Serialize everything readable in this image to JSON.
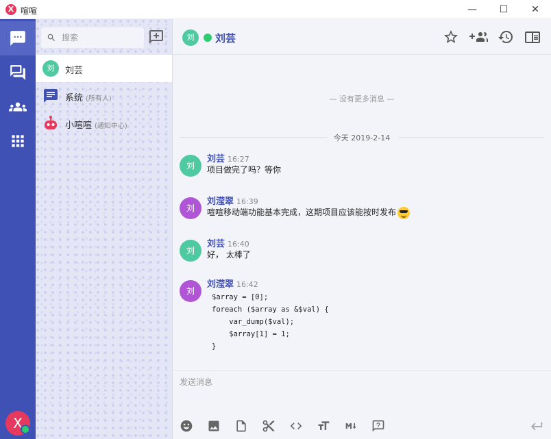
{
  "window": {
    "title": "喧喧",
    "logo": "X",
    "minimize_glyph": "—",
    "maximize_glyph": "☐",
    "close_glyph": "✕"
  },
  "nav": {
    "items": [
      {
        "icon": "chat-bubble-icon",
        "active": true
      },
      {
        "icon": "chats-icon",
        "active": false
      },
      {
        "icon": "contacts-icon",
        "active": false
      },
      {
        "icon": "apps-grid-icon",
        "active": false
      }
    ],
    "user_initial": "X",
    "user_status_color": "#2ecc71",
    "background": "#3f51b5"
  },
  "chatlist": {
    "search_placeholder": "搜索",
    "items": [
      {
        "avatar": "刘",
        "avatar_color": "#4fc99f",
        "name": "刘芸",
        "sub": "",
        "active": true
      },
      {
        "avatar": "",
        "icon": "system-notice-icon",
        "name": "系统",
        "sub": "(所有人)",
        "active": false
      },
      {
        "avatar": "",
        "icon": "robot-icon",
        "name": "小喧喧",
        "sub": "(通知中心)",
        "active": false
      }
    ]
  },
  "chat": {
    "avatar": "刘",
    "avatar_color": "#4fc99f",
    "title": "刘芸",
    "online_color": "#2ecc71",
    "header_actions": [
      "star-icon",
      "add-member-icon",
      "history-icon",
      "sidebar-toggle-icon"
    ],
    "no_more": "— 没有更多消息 —",
    "date_label": "今天 2019-2-14",
    "messages": [
      {
        "avatar": "刘",
        "avatar_color": "#4fc99f",
        "sender": "刘芸",
        "time": "16:27",
        "text": "项目做完了吗？等你"
      },
      {
        "avatar": "刘",
        "avatar_color": "#b055d5",
        "sender": "刘滢翠",
        "time": "16:39",
        "text": "喧喧移动端功能基本完成，这期项目应该能按时发布",
        "emoji": "sunglasses-emoji"
      },
      {
        "avatar": "刘",
        "avatar_color": "#4fc99f",
        "sender": "刘芸",
        "time": "16:40",
        "text": "好， 太棒了"
      },
      {
        "avatar": "刘",
        "avatar_color": "#b055d5",
        "sender": "刘滢翠",
        "time": "16:42",
        "code": "$array = [0];\nforeach ($array as &$val) {\n    var_dump($val);\n    $array[1] = 1;\n}"
      }
    ],
    "composer_placeholder": "发送消息",
    "toolbar": [
      "emoji-icon",
      "image-icon",
      "file-icon",
      "screenshot-icon",
      "code-icon",
      "text-format-icon",
      "markdown-icon",
      "help-icon"
    ],
    "send_icon": "send-enter-icon"
  }
}
